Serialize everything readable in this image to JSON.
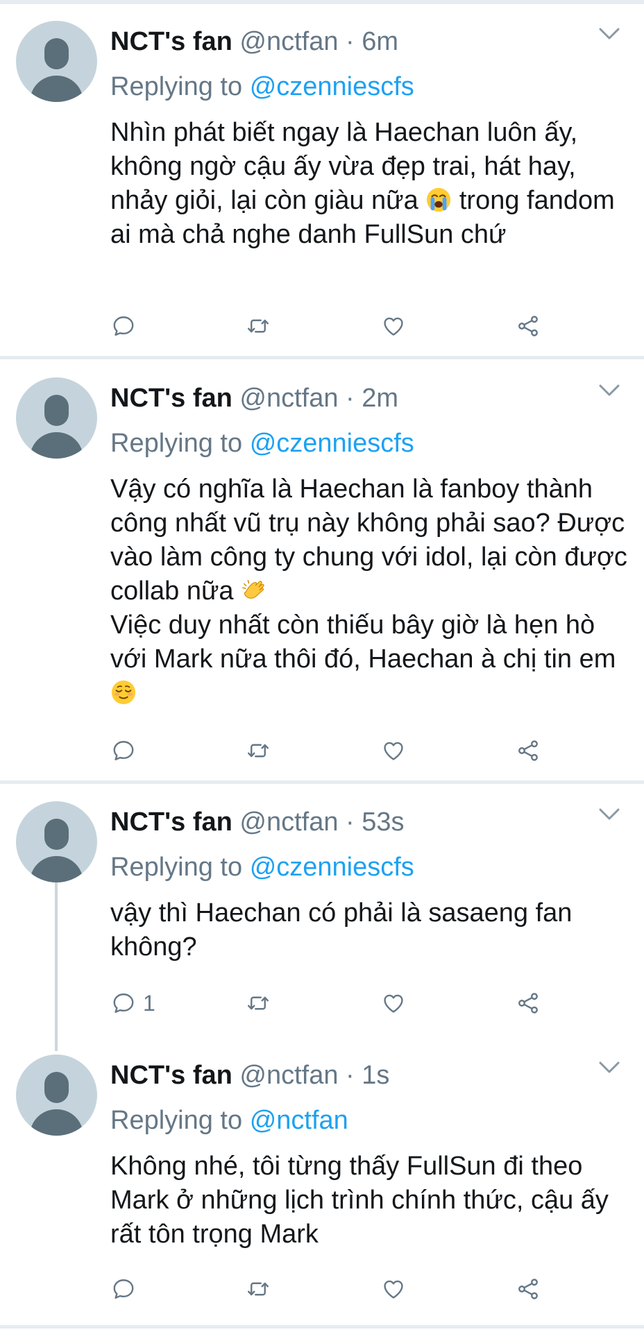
{
  "colors": {
    "accent": "#1da1f2",
    "text": "#14171a",
    "muted": "#657786",
    "separator": "#e6ecf0",
    "avatar_bg": "#c5d4dc",
    "avatar_fg": "#5b6f7a"
  },
  "tweets": [
    {
      "name": "NCT's fan",
      "handle": "@nctfan",
      "dot": "·",
      "time": "6m",
      "reply_prefix": "Replying to",
      "reply_to": "@czenniescfs",
      "lines": [
        "Nhìn phát biết ngay là Haechan luôn ấy, không ngờ cậu ấy vừa đẹp trai, hát hay, nhảy giỏi, lại còn giàu nữa",
        "trong fandom ai mà chả nghe danh FullSun chứ"
      ],
      "emoji": "loudly-crying-face-icon",
      "reply_count": ""
    },
    {
      "name": "NCT's fan",
      "handle": "@nctfan",
      "dot": "·",
      "time": "2m",
      "reply_prefix": "Replying to",
      "reply_to": "@czenniescfs",
      "lines": [
        "Vậy có nghĩa là Haechan là fanboy thành công nhất vũ trụ này không phải sao? Được vào làm công ty chung với idol, lại còn được collab nữa",
        "Việc duy nhất còn thiếu bây giờ là hẹn hò với Mark nữa thôi đó, Haechan à chị tin em"
      ],
      "emoji": "clapping-hands-icon",
      "emoji2": "relieved-face-icon",
      "reply_count": ""
    },
    {
      "name": "NCT's fan",
      "handle": "@nctfan",
      "dot": "·",
      "time": "53s",
      "reply_prefix": "Replying to",
      "reply_to": "@czenniescfs",
      "lines": [
        "vậy thì Haechan có phải là sasaeng fan không?"
      ],
      "reply_count": "1"
    },
    {
      "name": "NCT's fan",
      "handle": "@nctfan",
      "dot": "·",
      "time": "1s",
      "reply_prefix": "Replying to",
      "reply_to": "@nctfan",
      "lines": [
        "Không nhé, tôi từng thấy FullSun đi theo Mark ở những lịch trình chính thức, cậu ấy rất tôn trọng Mark"
      ],
      "reply_count": ""
    }
  ],
  "action_icons": [
    "reply-icon",
    "retweet-icon",
    "like-icon",
    "share-icon"
  ]
}
